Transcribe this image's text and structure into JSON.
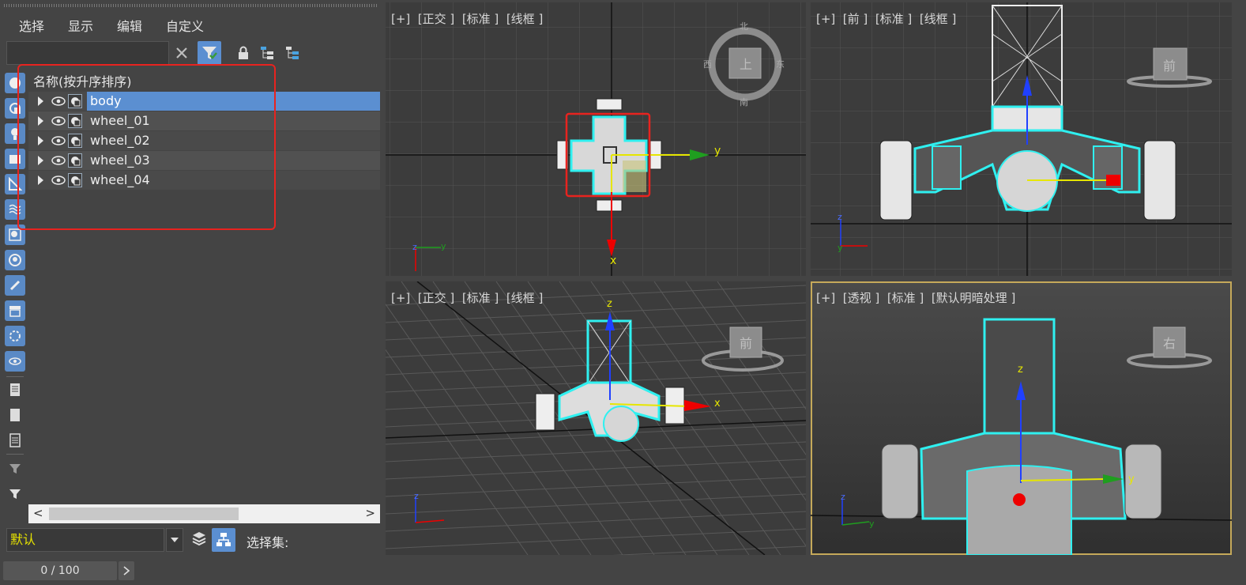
{
  "menu": [
    "选择",
    "显示",
    "编辑",
    "自定义"
  ],
  "tree": {
    "header": "名称(按升序排序)",
    "items": [
      {
        "name": "body",
        "selected": true
      },
      {
        "name": "wheel_01",
        "selected": false
      },
      {
        "name": "wheel_02",
        "selected": false
      },
      {
        "name": "wheel_03",
        "selected": false
      },
      {
        "name": "wheel_04",
        "selected": false
      }
    ]
  },
  "bottom": {
    "layer_value": "默认",
    "selection_set_label": "选择集:"
  },
  "status": {
    "frame": "0 / 100"
  },
  "viewports": {
    "top_left": {
      "label": "[+]  [正交 ]  [标准 ]  [线框 ]"
    },
    "top_right": {
      "label": "[+]  [前 ]  [标准 ]  [线框 ]"
    },
    "bottom_left": {
      "label": "[+]  [正交 ]  [标准 ]  [线框 ]"
    },
    "bottom_right": {
      "label": "[+]  [透视 ]  [标准 ]  [默认明暗处理 ]"
    }
  },
  "viewcube": {
    "top_face": "上",
    "front_face": "前",
    "right_face": "右",
    "top_ring_north": "北",
    "top_ring_south": "南",
    "top_ring_west": "西",
    "top_ring_east": "东"
  },
  "axes": {
    "x": "x",
    "y": "y",
    "z": "z"
  },
  "colors": {
    "selection_blue": "#5b8fd1",
    "annotation_red": "#e8231f",
    "wire_cyan": "#2ff0f0",
    "active_viewport": "#c5a95a",
    "layer_yellow": "#e6e200"
  }
}
